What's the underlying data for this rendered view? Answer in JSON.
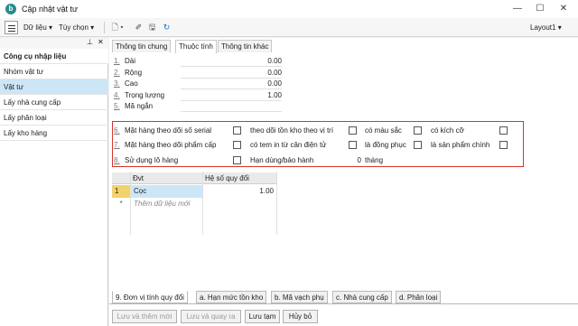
{
  "window": {
    "title": "Cập nhật vật tư",
    "app_icon_letter": "b",
    "minimize": "—",
    "maximize": "☐",
    "close": "✕"
  },
  "toolbar": {
    "data_menu": "Dữ liệu ▾",
    "options_menu": "Tùy chọn ▾",
    "new_icon": "🗋 ▾",
    "clear_icon": "✐",
    "save_icon": "🖫",
    "refresh_icon": "↻",
    "layout": "Layout1 ▾"
  },
  "left_panel": {
    "pin": "⊥",
    "close": "✕",
    "items": [
      {
        "label": "Công cụ nhập liệu",
        "type": "head"
      },
      {
        "label": "Nhóm vật tư"
      },
      {
        "label": "Vật tư",
        "selected": true
      },
      {
        "label": "Lấy nhà cung cấp"
      },
      {
        "label": "Lấy phân loại"
      },
      {
        "label": "Lấy kho hàng"
      }
    ]
  },
  "tabs": [
    {
      "label": "Thông tin chung"
    },
    {
      "label": "Thuộc tính",
      "active": true
    },
    {
      "label": "Thông tin khác"
    }
  ],
  "fields": [
    {
      "num": "1.",
      "label": "Dài",
      "value": "0.00"
    },
    {
      "num": "2.",
      "label": "Rộng",
      "value": "0.00"
    },
    {
      "num": "3.",
      "label": "Cao",
      "value": "0.00"
    },
    {
      "num": "4.",
      "label": "Trọng lượng",
      "value": "1.00"
    },
    {
      "num": "5.",
      "label": "Mã ngắn",
      "value": ""
    }
  ],
  "checkboxes": {
    "row6": {
      "num": "6.",
      "items": [
        "Mặt hàng theo dõi số serial",
        "theo dõi tồn kho theo vị trí",
        "có màu sắc",
        "có kích cỡ"
      ]
    },
    "row7": {
      "num": "7.",
      "items": [
        "Mặt hàng theo dõi phẩm cấp",
        "có tem in từ cân điện tử",
        "là đồng phục",
        "là sản phẩm chính"
      ]
    },
    "row8": {
      "num": "8.",
      "label": "Sử dụng lô hàng",
      "expiry_label": "Hạn dùng/bảo hành",
      "expiry_value": "0",
      "unit": "tháng"
    }
  },
  "grid": {
    "columns": [
      "Đvt",
      "Hệ số quy đổi"
    ],
    "rows": [
      {
        "num": "1",
        "unit": "Cọc",
        "factor": "1.00"
      }
    ],
    "new_row_placeholder": "Thêm dữ liệu mới",
    "new_row_marker": "*"
  },
  "bottom_tabs": [
    {
      "label": "9. Đơn vị tính quy đổi",
      "active": true
    },
    {
      "label": "a. Hạn mức tồn kho"
    },
    {
      "label": "b. Mã vạch phụ"
    },
    {
      "label": "c. Nhà cung cấp"
    },
    {
      "label": "d. Phân loại"
    }
  ],
  "buttons": [
    {
      "label": "Lưu và thêm mới",
      "disabled": true
    },
    {
      "label": "Lưu và quay ra",
      "disabled": true
    },
    {
      "label": "Lưu tạm"
    },
    {
      "label": "Hủy bỏ"
    }
  ]
}
